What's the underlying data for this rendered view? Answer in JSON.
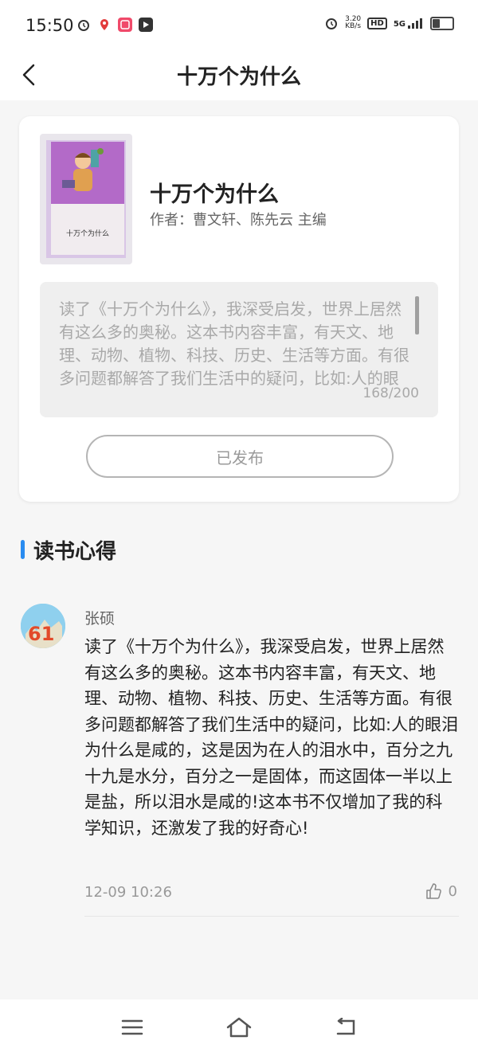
{
  "status_bar": {
    "time": "15:50",
    "net_speed_value": "3.20",
    "net_speed_unit": "KB/s",
    "hd_label": "HD",
    "signal_label": "5G",
    "battery_level": 0.4
  },
  "header": {
    "title": "十万个为什么"
  },
  "book": {
    "cover_title": "十万个为什么",
    "title": "十万个为什么",
    "author": "作者：曹文轩、陈先云 主编"
  },
  "review_input": {
    "text": "读了《十万个为什么》，我深受启发，世界上居然有这么多的奥秘。这本书内容丰富，有天文、地理、动物、植物、科技、历史、生活等方面。有很多问题都解答了我们生活中的疑问，比如:人的眼泪为什么是咸的，这是因为在人的泪水中，百分之九十九是水分，百分之一是固体，而这固体一半以上是盐，所以泪水是咸的!这本书不仅增加了我的科学知识，还激发了我的好奇心!",
    "counter": "168/200"
  },
  "published_button": {
    "label": "已发布"
  },
  "section": {
    "title": "读书心得"
  },
  "comments": [
    {
      "name": "张硕",
      "text": "读了《十万个为什么》，我深受启发，世界上居然有这么多的奥秘。这本书内容丰富，有天文、地理、动物、植物、科技、历史、生活等方面。有很多问题都解答了我们生活中的疑问，比如:人的眼泪为什么是咸的，这是因为在人的泪水中，百分之九十九是水分，百分之一是固体，而这固体一半以上是盐，所以泪水是咸的!这本书不仅增加了我的科学知识，还激发了我的好奇心!",
      "time": "12-09 10:26",
      "likes": "0"
    }
  ],
  "nav_bar": {
    "icons": [
      "menu-icon",
      "home-icon",
      "back-icon"
    ]
  }
}
